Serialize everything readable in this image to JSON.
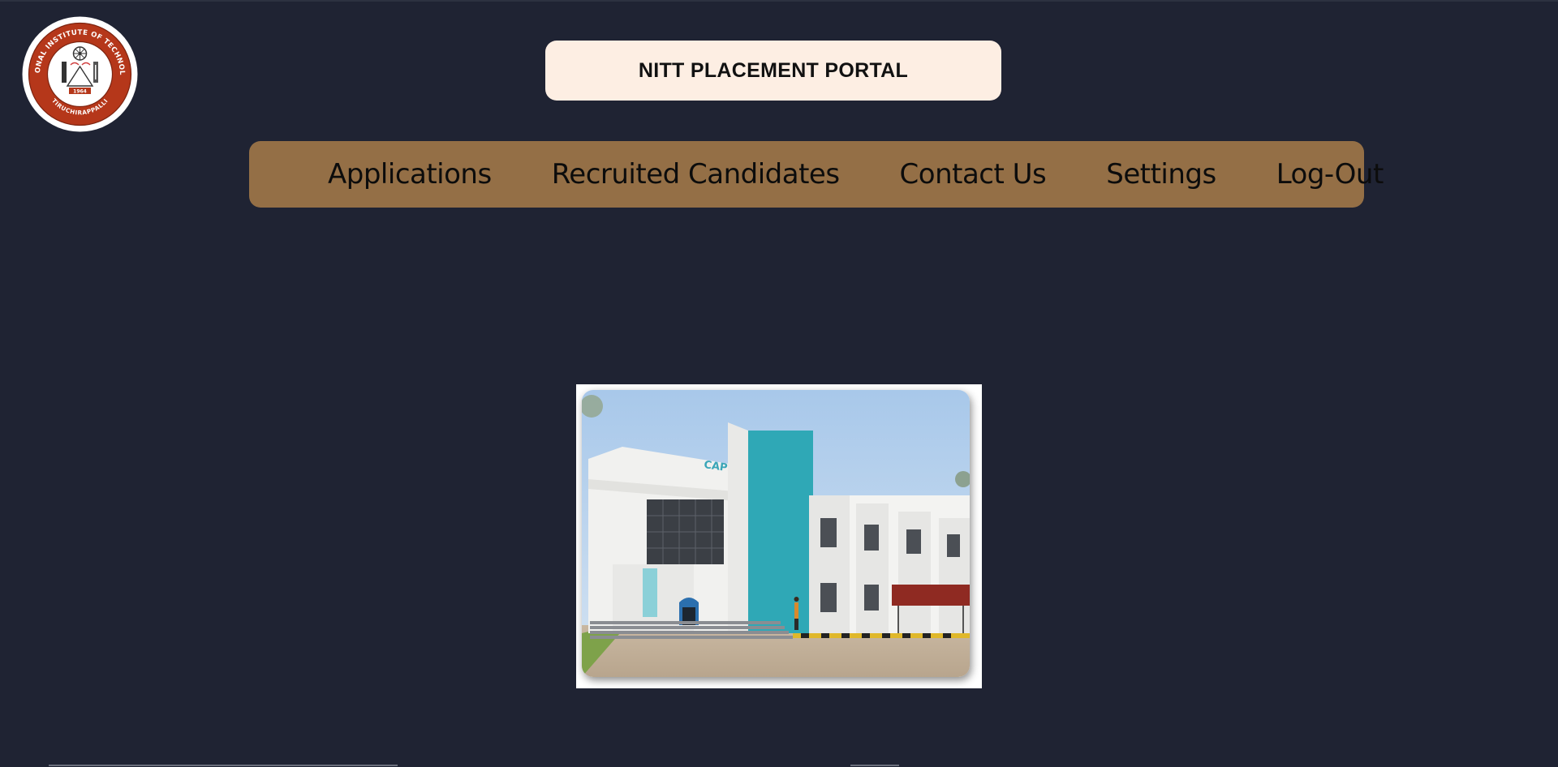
{
  "header": {
    "title": "NITT PLACEMENT PORTAL",
    "logo": {
      "icon": "nitt-seal-logo",
      "ring_text": "NATIONAL INSTITUTE OF TECHNOLOGY",
      "bottom_text": "TIRUCHIRAPPALLI",
      "year": "1964"
    }
  },
  "nav": {
    "items": [
      {
        "label": "Applications"
      },
      {
        "label": "Recruited Candidates"
      },
      {
        "label": "Contact Us"
      },
      {
        "label": "Settings"
      },
      {
        "label": "Log-Out"
      }
    ]
  },
  "main": {
    "photo": {
      "icon": "capstone-building-photo",
      "sign_text": "CAPSTONE"
    }
  },
  "colors": {
    "background": "#1f2333",
    "title_banner": "#fdeee3",
    "nav_bar": "#946f46",
    "logo_red": "#b5371a"
  }
}
